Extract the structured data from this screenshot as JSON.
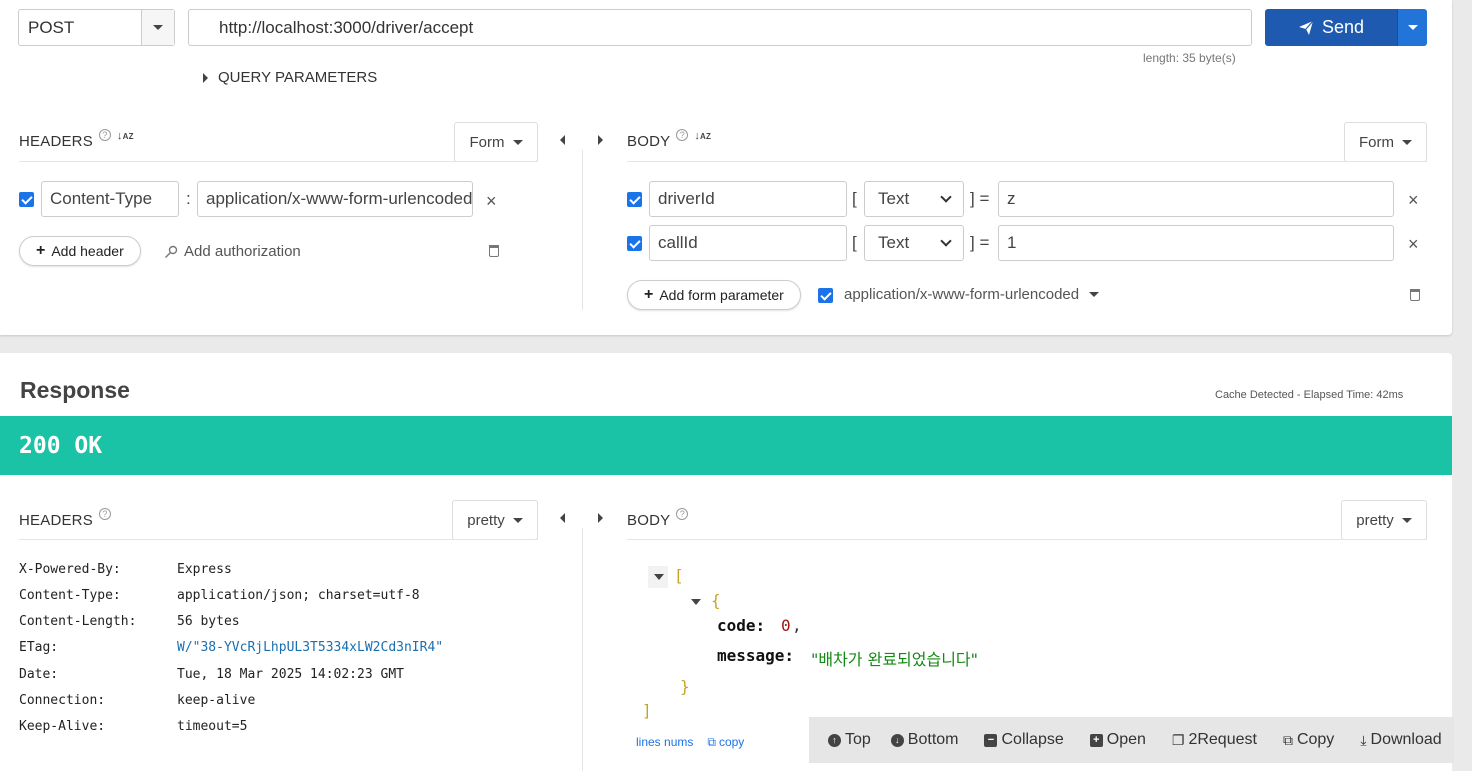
{
  "request": {
    "method": "POST",
    "url": "http://localhost:3000/driver/accept",
    "send_label": "Send",
    "length_note": "length: 35 byte(s)",
    "query_params_label": "QUERY PARAMETERS",
    "headers": {
      "title": "HEADERS",
      "help": "?",
      "form_label": "Form",
      "items": [
        {
          "name": "Content-Type",
          "value": "application/x-www-form-urlencoded",
          "checked": true
        }
      ],
      "add_header_label": "Add header",
      "add_auth_label": "Add authorization"
    },
    "body": {
      "title": "BODY",
      "help": "?",
      "form_label": "Form",
      "params": [
        {
          "name": "driverId",
          "type": "Text",
          "value": "z",
          "checked": true
        },
        {
          "name": "callId",
          "type": "Text",
          "value": "1",
          "checked": true
        }
      ],
      "add_param_label": "Add form parameter",
      "content_type": "application/x-www-form-urlencoded"
    }
  },
  "response": {
    "title": "Response",
    "cache_note": "Cache Detected - Elapsed Time: 42ms",
    "status": "200 OK",
    "headers_title": "HEADERS",
    "pretty_label": "pretty",
    "body_title": "BODY",
    "headers": [
      {
        "key": "X-Powered-By:",
        "value": "Express",
        "link": false
      },
      {
        "key": "Content-Type:",
        "value": "application/json; charset=utf-8",
        "link": false
      },
      {
        "key": "Content-Length:",
        "value": "56 bytes",
        "link": false
      },
      {
        "key": "ETag:",
        "value": "W/\"38-YVcRjLhpUL3T5334xLW2Cd3nIR4\"",
        "link": true
      },
      {
        "key": "Date:",
        "value": "Tue, 18 Mar 2025 14:02:23 GMT",
        "link": false
      },
      {
        "key": "Connection:",
        "value": "keep-alive",
        "link": false
      },
      {
        "key": "Keep-Alive:",
        "value": "timeout=5",
        "link": false
      }
    ],
    "json": {
      "open_array": "[",
      "open_obj": "{",
      "code_key": "code:",
      "code_value": "0",
      "comma": ",",
      "message_key": "message:",
      "message_value": "\"배차가 완료되었습니다\"",
      "close_obj": "}",
      "close_array": "]"
    },
    "lines_nums_label": "lines nums",
    "copy_label": "copy",
    "toolbar": {
      "top": "Top",
      "bottom": "Bottom",
      "collapse": "Collapse",
      "open": "Open",
      "to_request": "2Request",
      "copy": "Copy",
      "download": "Download"
    }
  },
  "colors": {
    "status_bar": "#1ac2a6",
    "send_button": "#1e5bb0",
    "checkbox": "#1a73e8"
  }
}
